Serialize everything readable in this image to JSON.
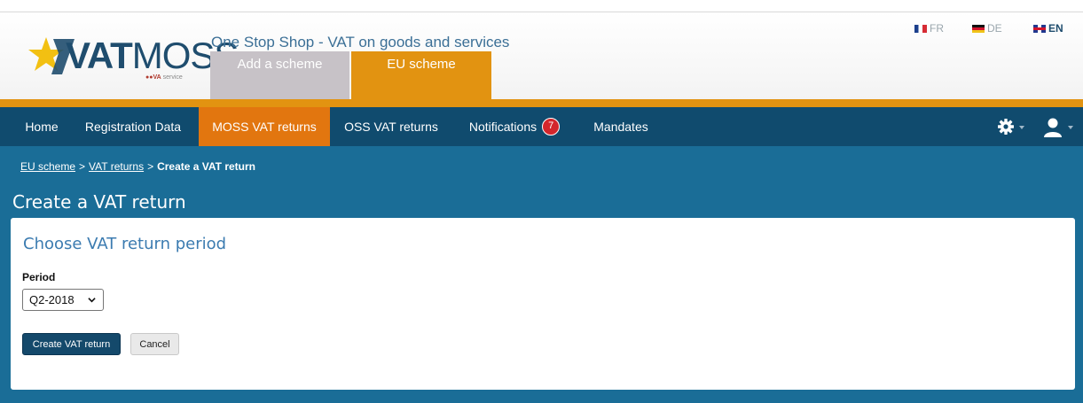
{
  "header": {
    "logo": {
      "vat": "VAT",
      "moss": "MOSS",
      "sub_prefix": "●●VA",
      "sub_text": " service"
    },
    "app_title": "One Stop Shop - VAT on goods and services",
    "scheme_tabs": [
      {
        "label": "Add a scheme",
        "active": false
      },
      {
        "label": "EU scheme",
        "active": true
      }
    ],
    "languages": [
      {
        "code": "FR",
        "active": false
      },
      {
        "code": "DE",
        "active": false
      },
      {
        "code": "EN",
        "active": true
      }
    ]
  },
  "nav": {
    "items": [
      {
        "label": "Home",
        "active": false
      },
      {
        "label": "Registration Data",
        "active": false
      },
      {
        "label": "MOSS VAT returns",
        "active": true
      },
      {
        "label": "OSS VAT returns",
        "active": false
      },
      {
        "label": "Notifications",
        "active": false,
        "badge": "7"
      },
      {
        "label": "Mandates",
        "active": false
      }
    ],
    "icons": [
      "gear-icon",
      "user-icon"
    ]
  },
  "breadcrumb": {
    "items": [
      "EU scheme",
      "VAT returns"
    ],
    "current": "Create a VAT return",
    "separator": ">"
  },
  "page": {
    "title": "Create a VAT return",
    "panel_title": "Choose VAT return period",
    "period_label": "Period",
    "period_value": "Q2-2018",
    "create_button": "Create VAT return",
    "cancel_button": "Cancel"
  },
  "colors": {
    "navbar": "#104b6e",
    "accent_orange": "#e29311",
    "active_nav": "#e2760f",
    "content_bg": "#1a6d97",
    "badge": "#d3262c"
  }
}
